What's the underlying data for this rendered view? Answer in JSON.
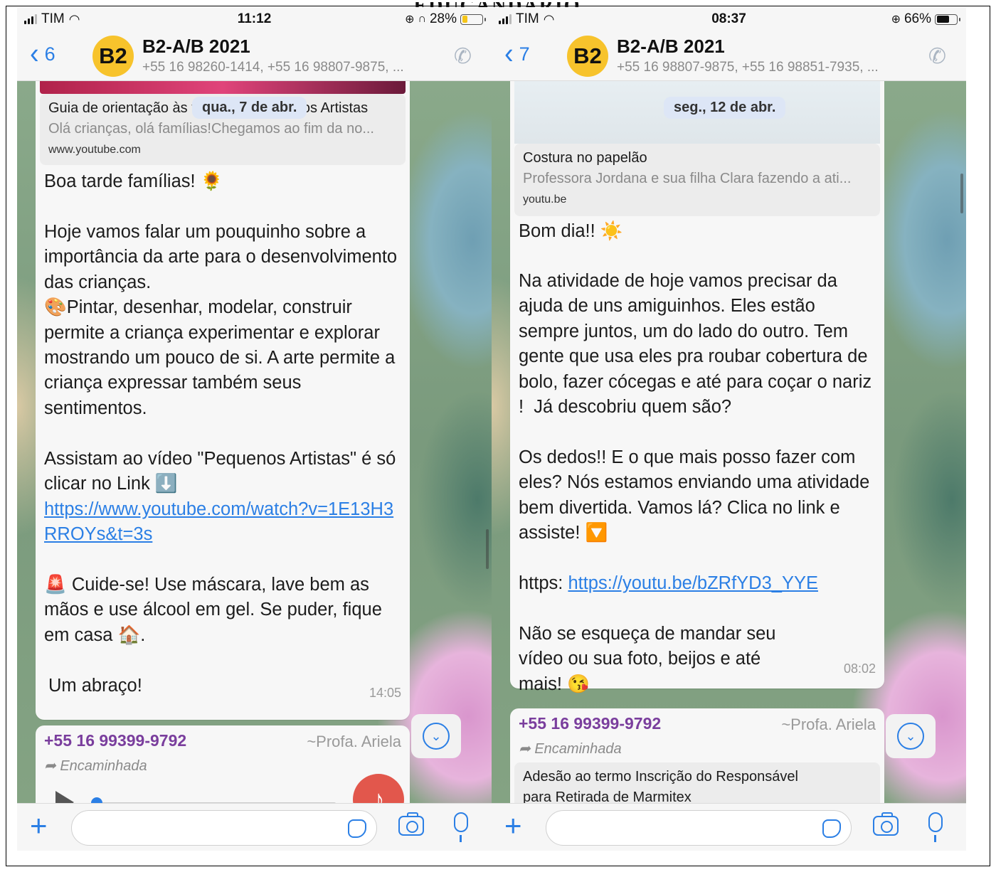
{
  "doc_fragment": "EDUCANDÁRIO",
  "left": {
    "status": {
      "carrier": "TIM",
      "time": "11:12",
      "battery_pct": "28%",
      "battery_level": 0.28,
      "battery_color": "#f5c518"
    },
    "header": {
      "back_count": "6",
      "avatar": "B2",
      "title": "B2-A/B 2021",
      "subtitle": "+55 16 98260-1414, +55 16 98807-9875, ..."
    },
    "date_pill": "qua., 7 de abr.",
    "preview": {
      "title": "Guia de orientação às famílias - Pequenos Artistas",
      "desc": "Olá crianças, olá famílias!Chegamos ao fim da no...",
      "url": "www.youtube.com"
    },
    "message": {
      "greeting": "Boa tarde famílias! 🌻",
      "body": "Hoje vamos falar um pouquinho sobre a importância da arte para o desenvolvimento das crianças.\n🎨Pintar, desenhar, modelar, construir permite a criança experimentar e explorar mostrando um pouco de si. A arte permite a criança expressar também seus sentimentos.",
      "cta": "Assistam ao vídeo \"Pequenos Artistas\" é só clicar no Link ⬇️",
      "link": "https://www.youtube.com/watch?v=1E13H3RROYs&t=3s",
      "warning": "🚨 Cuide-se! Use máscara, lave bem as mãos e use álcool em gel. Se puder, fique em casa 🏠.",
      "closing": "Um abraço!",
      "time": "14:05"
    },
    "next": {
      "sender": "+55 16 99399-9792",
      "alias": "~Profa. Ariela",
      "forwarded": "Encaminhada"
    }
  },
  "right": {
    "status": {
      "carrier": "TIM",
      "time": "08:37",
      "battery_pct": "66%",
      "battery_level": 0.66,
      "battery_color": "#111111"
    },
    "header": {
      "back_count": "7",
      "avatar": "B2",
      "title": "B2-A/B 2021",
      "subtitle": "+55 16 98807-9875, +55 16 98851-7935, ..."
    },
    "date_pill": "seg., 12 de abr.",
    "preview": {
      "title": "Costura no papelão",
      "desc": "Professora Jordana e sua filha Clara fazendo a ati...",
      "url": "youtu.be"
    },
    "message": {
      "greeting": "Bom dia!! ☀️",
      "body": "Na atividade de hoje vamos precisar da ajuda de uns amiguinhos. Eles estão sempre juntos, um do lado do outro. Tem gente que usa eles pra roubar cobertura de bolo, fazer cócegas e até para coçar o nariz !  Já descobriu quem são?",
      "body2": "Os dedos!! E o que mais posso fazer com eles? Nós estamos enviando uma atividade bem divertida. Vamos lá? Clica no link e assiste! 🔽",
      "link_prefix": "https: ",
      "link": "https://youtu.be/bZRfYD3_YYE",
      "closing": "Não se esqueça de mandar seu vídeo ou sua foto, beijos e até mais! 😘",
      "time": "08:02"
    },
    "next": {
      "sender": "+55 16 99399-9792",
      "alias": "~Profa. Ariela",
      "forwarded": "Encaminhada",
      "preview_text": "Adesão ao termo Inscrição do Responsável para Retirada de Marmitex"
    }
  },
  "icons": {
    "back": "chevron-left-icon",
    "call": "add-call-icon",
    "plus": "plus-icon",
    "sticker": "sticker-icon",
    "camera": "camera-icon",
    "mic": "microphone-icon",
    "scroll": "chevron-down-circle-icon",
    "forward": "forward-arrow-icon",
    "wifi": "wifi-icon",
    "signal": "signal-bars-icon",
    "battery": "battery-icon",
    "lock": "rotation-lock-icon",
    "headphones": "headphones-icon"
  },
  "colors": {
    "accent": "#2b7fe5",
    "avatar_bg": "#f7c32c",
    "sender": "#7a3e9d",
    "date_pill": "#dde6f6"
  }
}
